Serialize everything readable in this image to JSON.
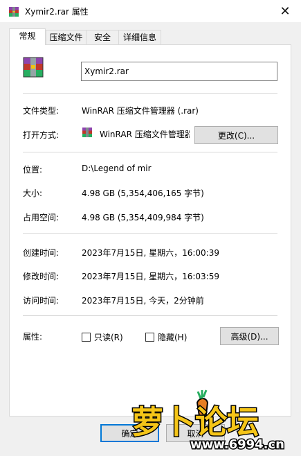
{
  "window": {
    "title": "Xymir2.rar 属性",
    "close_glyph": "✕"
  },
  "tabs": [
    {
      "label": "常规",
      "active": true
    },
    {
      "label": "压缩文件",
      "active": false
    },
    {
      "label": "安全",
      "active": false
    },
    {
      "label": "详细信息",
      "active": false
    }
  ],
  "general": {
    "filename": "Xymir2.rar",
    "file_type_label": "文件类型:",
    "file_type_value": "WinRAR 压缩文件管理器 (.rar)",
    "opens_with_label": "打开方式:",
    "opens_with_value": "WinRAR 压缩文件管理器",
    "change_button": "更改(C)...",
    "location_label": "位置:",
    "location_value": "D:\\Legend of mir",
    "size_label": "大小:",
    "size_value": "4.98 GB (5,354,406,165 字节)",
    "size_on_disk_label": "占用空间:",
    "size_on_disk_value": "4.98 GB (5,354,409,984 字节)",
    "created_label": "创建时间:",
    "created_value": "2023年7月15日, 星期六，16:00:39",
    "modified_label": "修改时间:",
    "modified_value": "2023年7月15日, 星期六，16:03:59",
    "accessed_label": "访问时间:",
    "accessed_value": "2023年7月15日, 今天，2分钟前",
    "attributes_label": "属性:",
    "readonly_label": "只读(R)",
    "readonly_checked": false,
    "hidden_label": "隐藏(H)",
    "hidden_checked": false,
    "advanced_button": "高级(D)..."
  },
  "footer": {
    "ok_button": "确定",
    "cancel_button": "取消"
  },
  "watermark": {
    "text": "萝卜论坛",
    "url": "www.6994.cn"
  },
  "colors": {
    "accent": "#0078d7",
    "winrar_red": "#c0392b",
    "winrar_purple": "#5b3a8c",
    "winrar_green": "#2e8b3e",
    "watermark_yellow": "#f5c518"
  }
}
